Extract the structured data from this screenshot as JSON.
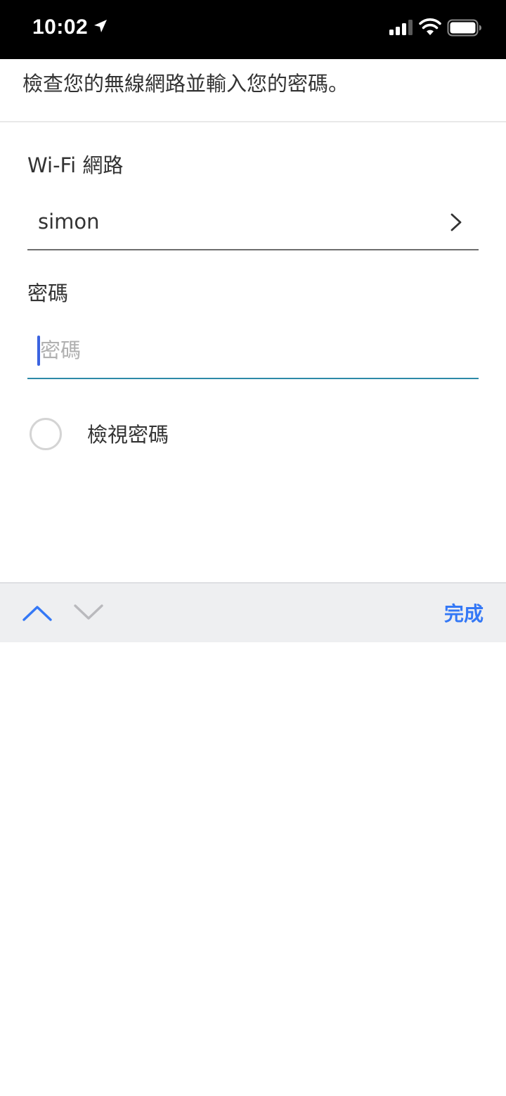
{
  "status_bar": {
    "time": "10:02",
    "icons": [
      "location-arrow-icon",
      "cellular-signal-icon",
      "wifi-icon",
      "battery-icon"
    ]
  },
  "instruction": "檢查您的無線網路並輸入您的密碼。",
  "wifi": {
    "label": "Wi-Fi 網路",
    "selected_network": "simon",
    "icon": "chevron-right-icon"
  },
  "password": {
    "label": "密碼",
    "value": "",
    "placeholder": "密碼"
  },
  "show_password": {
    "label": "檢視密碼",
    "checked": false
  },
  "keyboard_toolbar": {
    "previous_icon": "chevron-up-icon",
    "next_icon": "chevron-down-icon",
    "done_label": "完成"
  },
  "colors": {
    "accent": "#3478f6",
    "caret": "#3b63e0",
    "focused_underline": "#2d8aa8",
    "text": "#333333",
    "placeholder": "#b0b0b0",
    "status_bar_bg": "#000000",
    "toolbar_bg": "#eeeff1"
  }
}
